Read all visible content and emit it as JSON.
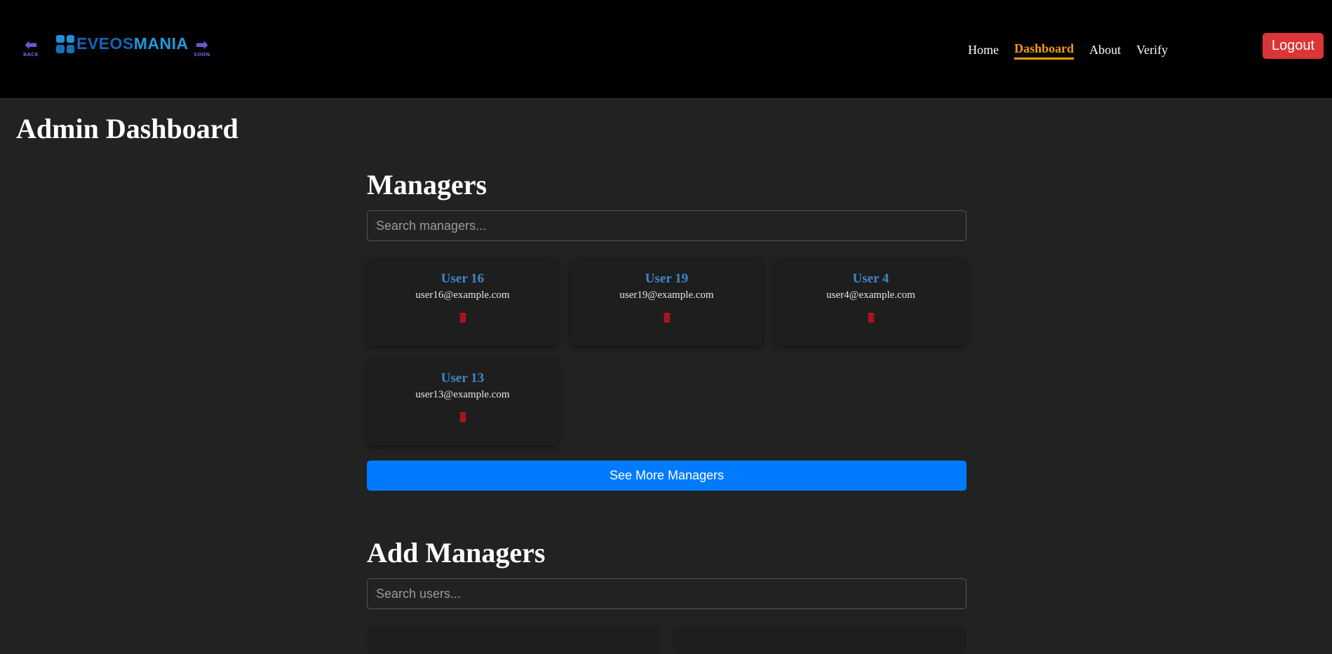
{
  "header": {
    "back_label": "BACK",
    "soon_label": "SOON",
    "logo_part1": "EVEOS",
    "logo_part2": "MANIA",
    "nav": [
      {
        "label": "Home"
      },
      {
        "label": "Dashboard",
        "active": true
      },
      {
        "label": "About"
      },
      {
        "label": "Verify"
      }
    ],
    "logout_label": "Logout"
  },
  "page_title": "Admin Dashboard",
  "managers": {
    "title": "Managers",
    "search_placeholder": "Search managers...",
    "cards": [
      {
        "name": "User 16",
        "email": "user16@example.com"
      },
      {
        "name": "User 19",
        "email": "user19@example.com"
      },
      {
        "name": "User 4",
        "email": "user4@example.com"
      },
      {
        "name": "User 13",
        "email": "user13@example.com"
      }
    ],
    "see_more_label": "See More Managers"
  },
  "add_managers": {
    "title": "Add Managers",
    "search_placeholder": "Search users..."
  },
  "icons": {
    "back": "arrow-left-icon",
    "soon": "arrow-right-icon",
    "delete": "trash-icon"
  },
  "colors": {
    "accent": "#f39c12",
    "link": "#3f87c8",
    "primary": "#007bff",
    "danger": "#dc3535",
    "trash": "#c0141c"
  }
}
